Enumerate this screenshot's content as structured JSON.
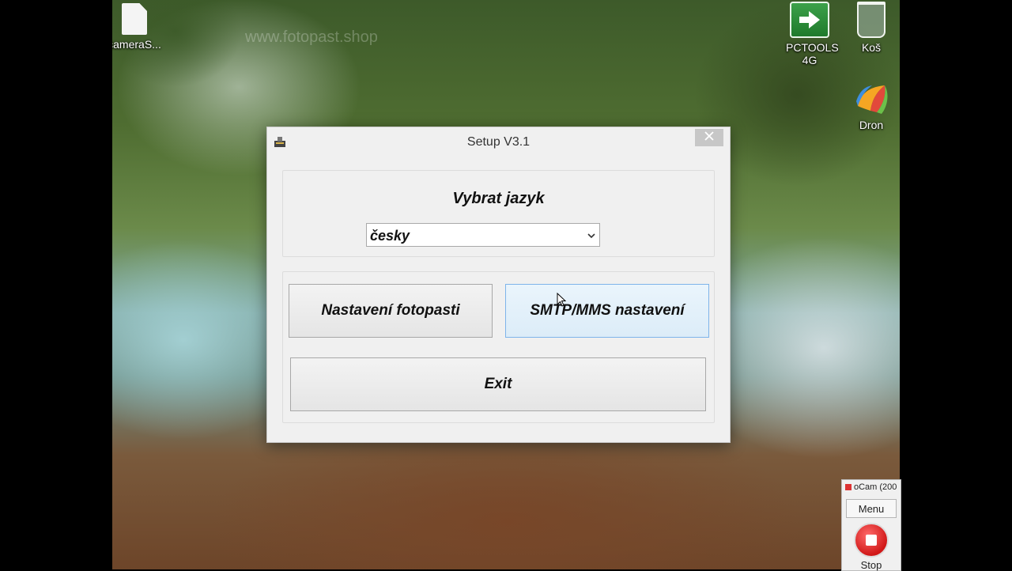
{
  "desktop": {
    "watermark": "www.fotopast.shop",
    "icons": [
      {
        "label": "cameraS...",
        "icon": "file-icon"
      },
      {
        "label": "PCTOOLS 4G",
        "icon": "pctools-arrow-icon"
      },
      {
        "label": "Koš",
        "icon": "recycle-bin-icon"
      },
      {
        "label": "Dron",
        "icon": "dron-app-icon"
      }
    ]
  },
  "dialog": {
    "title": "Setup V3.1",
    "language_label": "Vybrat jazyk",
    "language_selected": "česky",
    "buttons": {
      "camera_settings": "Nastavení fotopasti",
      "smtp_settings": "SMTP/MMS nastavení",
      "exit": "Exit"
    }
  },
  "ocam": {
    "title": "oCam (200",
    "menu_label": "Menu",
    "stop_label": "Stop"
  },
  "colors": {
    "dialog_bg": "#f0f0f0",
    "hover_button_bg": "#dcecf8",
    "hover_button_border": "#7eb4ea",
    "close_button_bg": "#c7c7c7",
    "stop_red": "#d11818"
  }
}
